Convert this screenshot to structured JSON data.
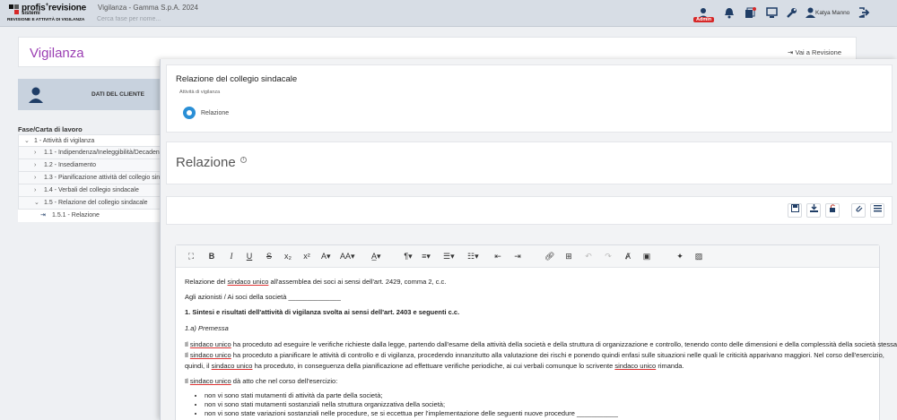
{
  "header": {
    "logo_brand": "profis",
    "logo_brand_suffix": "revisione",
    "logo_sub1": "sistemi",
    "logo_sub2": "REVISIONE E ATTIVITÀ DI VIGILANZA",
    "app_title": "Vigilanza - Gamma S.p.A. 2024",
    "search_placeholder": "Cerca fase per nome...",
    "admin_badge": "Admin",
    "user_name": "Katya Manno"
  },
  "page": {
    "title": "Vigilanza",
    "vai_link": "Vai a Revisione",
    "cliente_label": "DATI DEL CLIENTE",
    "tree_title": "Fase/Carta di lavoro",
    "tree": [
      {
        "label": "1 - Attività di vigilanza",
        "level": 1
      },
      {
        "label": "1.1 - Indipendenza/Ineleggibilità/Decadenza",
        "level": 2
      },
      {
        "label": "1.2 - Insediamento",
        "level": 2
      },
      {
        "label": "1.3 - Pianificazione attività del collegio sindacale",
        "level": 2
      },
      {
        "label": "1.4 - Verbali del collegio sindacale",
        "level": 2
      },
      {
        "label": "1.5 - Relazione del collegio sindacale",
        "level": 2
      },
      {
        "label": "1.5.1 - Relazione",
        "level": 3
      }
    ]
  },
  "panel": {
    "title": "Relazione del collegio sindacale",
    "crumb": "Attività di vigilanza",
    "step_label": "Relazione",
    "section_heading": "Relazione"
  },
  "document": {
    "line1_a": "Relazione del ",
    "line1_u": "sindaco unico",
    "line1_b": " all'assemblea dei soci ai sensi dell'art. 2429, comma 2, c.c.",
    "line2": "Agli azionisti / Ai soci della società ______________",
    "heading1": "1. Sintesi e risultati dell'attività di vigilanza svolta ai sensi dell'art. 2403 e seguenti c.c.",
    "subheading": "1.a) Premessa",
    "p1_a": "Il ",
    "p1_u": "sindaco unico",
    "p1_b": " ha proceduto ad eseguire le verifiche richieste dalla legge, partendo dall'esame della attività della società e della struttura di organizzazione e controllo, tenendo conto delle dimensioni e della complessità della società stessa.",
    "p2_a": "Il ",
    "p2_u": "sindaco unico",
    "p2_b": " ha proceduto a pianificare le attività di controllo e di vigilanza, procedendo innanzitutto alla valutazione dei rischi e ponendo quindi enfasi sulle situazioni nelle quali le criticità apparivano maggiori. Nel corso dell'esercizio,",
    "p3_a": "quindi, il ",
    "p3_u": "sindaco unico",
    "p3_b": " ha proceduto, in conseguenza della pianificazione ad effettuare verifiche periodiche, ai cui verbali comunque lo scrivente ",
    "p3_u2": "sindaco unico",
    "p3_c": " rimanda.",
    "p4_a": "Il ",
    "p4_u": "sindaco unico",
    "p4_b": " dà atto che nel corso dell'esercizio:",
    "bullets": [
      "non vi sono stati mutamenti di attività da parte della società;",
      "non vi sono stati mutamenti sostanziali nella struttura organizzativa della società;",
      "non vi sono state variazioni sostanziali nelle procedure, se si eccettua per l'implementazione delle seguenti nuove procedure ___________"
    ]
  },
  "toolbar_icons": [
    "fullscreen-icon",
    "bold-icon",
    "italic-icon",
    "underline-icon",
    "strikethrough-icon",
    "subscript-icon",
    "superscript-icon",
    "font-color-icon",
    "font-size-icon",
    "paint-format-icon",
    "paragraph-icon",
    "align-icon",
    "ordered-list-icon",
    "unordered-list-icon",
    "outdent-icon",
    "indent-icon",
    "link-icon",
    "table-icon",
    "undo-icon",
    "redo-icon",
    "clear-format-icon",
    "select-all-icon",
    "special-char-icon",
    "image-icon"
  ],
  "colors": {
    "accent_title": "#9b3fb3",
    "primary": "#1f3d66",
    "step": "#2a8fd6",
    "admin": "#d62828"
  }
}
